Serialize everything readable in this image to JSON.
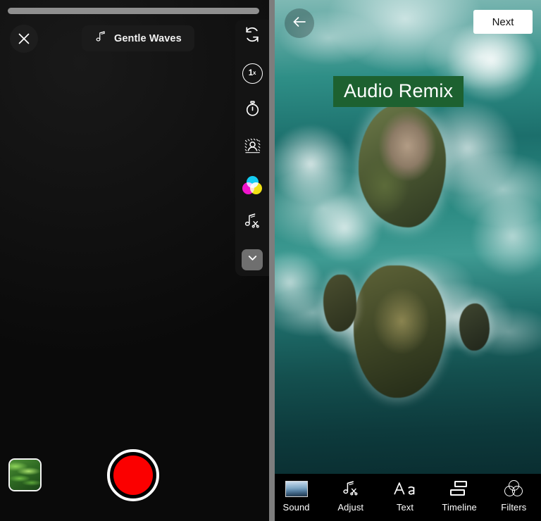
{
  "left_panel": {
    "progress_bar": {
      "name": "recording-progress",
      "value_percent": 100
    },
    "close_label": "Close",
    "sound_pill": {
      "icon": "music-note-icon",
      "label": "Gentle Waves"
    },
    "tools": [
      {
        "icon": "flip-camera-icon",
        "label": "Flip camera"
      },
      {
        "icon": "speed-icon",
        "label": "1",
        "sup": "x"
      },
      {
        "icon": "timer-icon",
        "label": "Timer"
      },
      {
        "icon": "beauty-portrait-icon",
        "label": "Beauty"
      },
      {
        "icon": "color-filter-icon",
        "label": "Filters"
      },
      {
        "icon": "music-trim-icon",
        "label": "Trim audio"
      },
      {
        "icon": "chevron-down-icon",
        "label": "More"
      }
    ],
    "gallery_thumb_label": "Gallery",
    "record_button_label": "Record"
  },
  "right_panel": {
    "back_label": "Back",
    "next_label": "Next",
    "text_overlay": {
      "text": "Audio Remix",
      "bg_color": "#1d6130",
      "text_color": "#ffffff"
    },
    "toolbar": [
      {
        "icon": "sound-thumbnail-icon",
        "label": "Sound"
      },
      {
        "icon": "music-trim-icon",
        "label": "Adjust"
      },
      {
        "icon": "text-aa-icon",
        "label": "Text"
      },
      {
        "icon": "timeline-layers-icon",
        "label": "Timeline"
      },
      {
        "icon": "filters-circles-icon",
        "label": "Filters"
      }
    ]
  },
  "colors": {
    "record_red": "#fb0000",
    "overlay_green": "#1d6130",
    "next_white": "#ffffff",
    "rail_bg": "#141414",
    "divider_grey": "#7d7d7d"
  }
}
